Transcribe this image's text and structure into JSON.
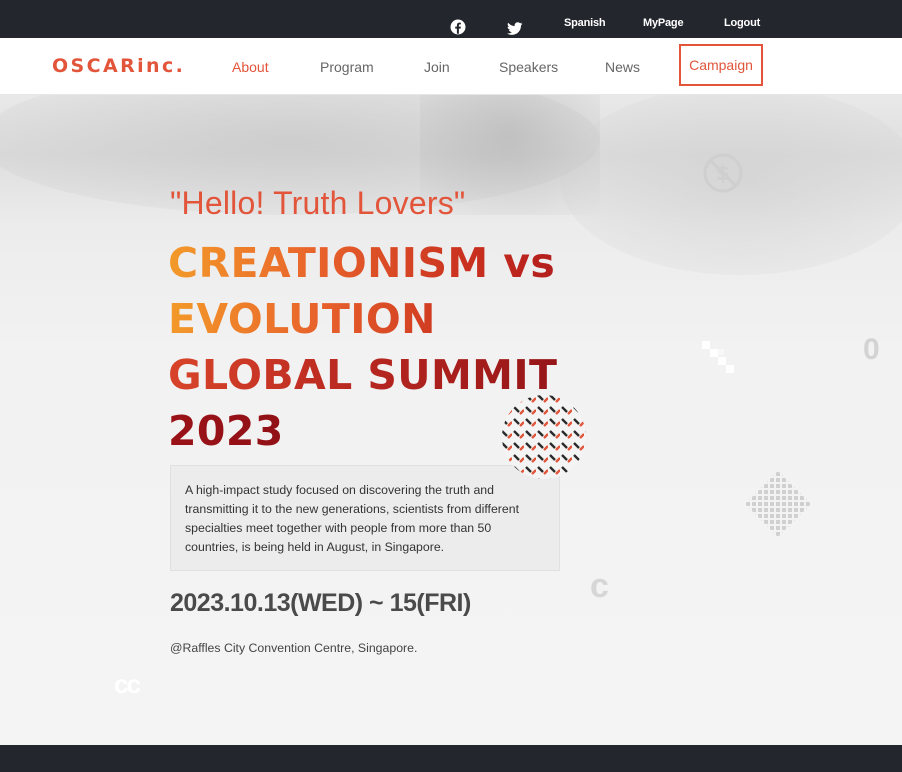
{
  "topbar": {
    "social": [
      {
        "icon": "facebook-icon"
      },
      {
        "icon": "twitter-icon"
      }
    ],
    "links": {
      "language": "Spanish",
      "mypage": "MyPage",
      "logout": "Logout"
    }
  },
  "nav": {
    "logo": "OSCARinc.",
    "items": [
      {
        "label": "About",
        "active": true
      },
      {
        "label": "Program"
      },
      {
        "label": "Join"
      },
      {
        "label": "Speakers"
      },
      {
        "label": "News"
      },
      {
        "label": "Campaign",
        "highlighted": true
      }
    ]
  },
  "hero": {
    "greeting": "\"Hello! Truth Lovers\"",
    "title_lines": [
      "CREATIONISM vs",
      "EVOLUTION",
      "GLOBAL SUMMIT",
      "2023"
    ],
    "description": "A high-impact study focused on discovering the truth and transmitting it to the new generations, scientists from different specialties meet together with people from more than 50 countries, is being held in August, in Singapore.",
    "date": "2023.10.13(WED) ~ 15(FRI)",
    "venue": "@Raffles City Convention Centre, Singapore."
  },
  "decorations": {
    "zero": "0",
    "c": "c",
    "cc": "cc"
  },
  "colors": {
    "accent": "#e2553a",
    "dark": "#23262d",
    "title_dark_red": "#8f1217"
  }
}
